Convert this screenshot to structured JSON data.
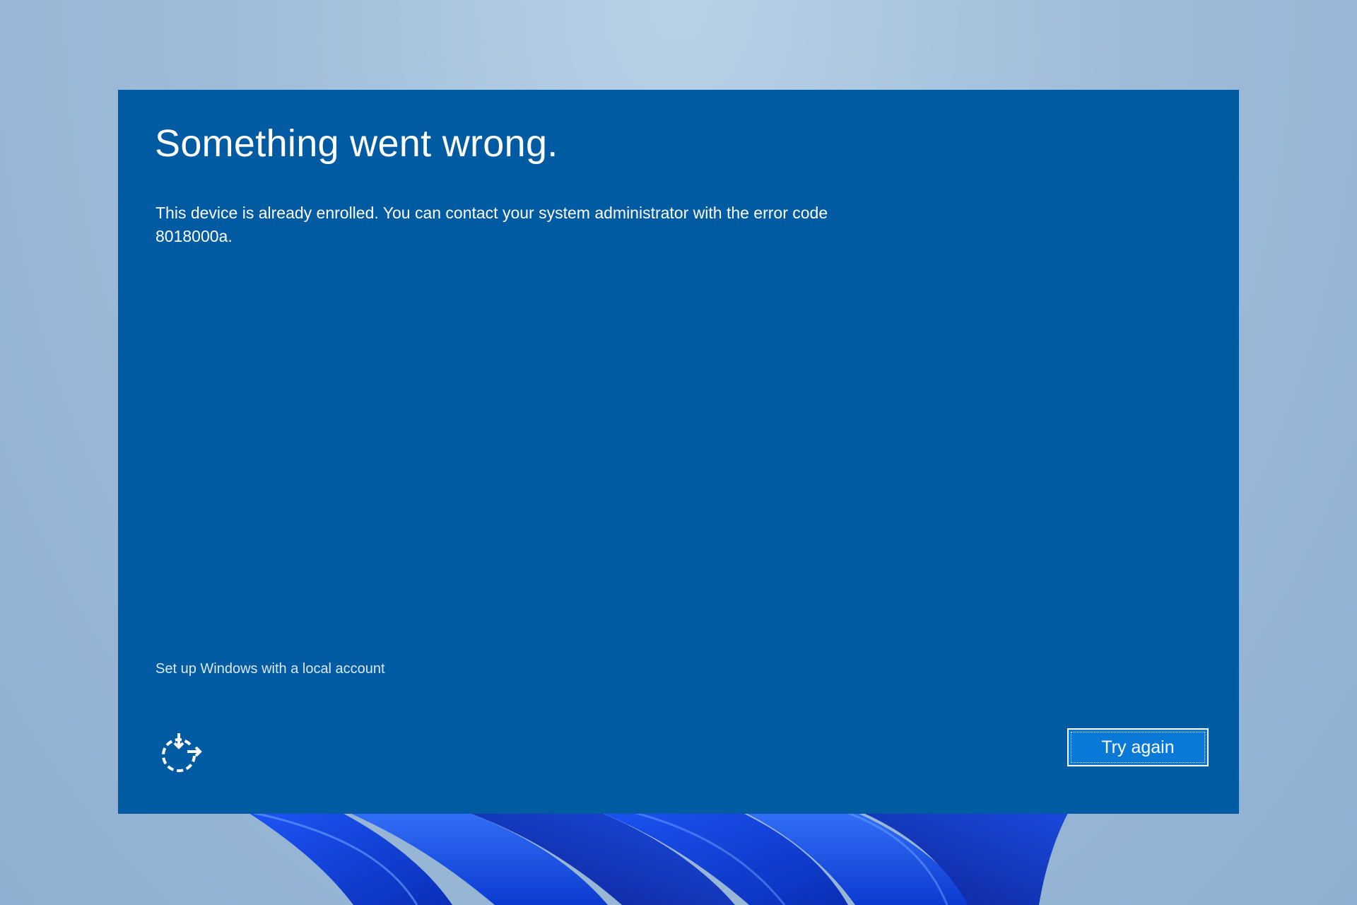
{
  "dialog": {
    "title": "Something went wrong.",
    "message": "This device is already enrolled. You can contact your system administrator with the error code 8018000a.",
    "local_account_link": "Set up Windows with a local account",
    "try_again_label": "Try again"
  },
  "icons": {
    "ease_of_access": "ease-of-access-icon"
  },
  "colors": {
    "dialog_background": "#005ba3",
    "button_background": "#0a78d6",
    "text": "#ffffff"
  }
}
